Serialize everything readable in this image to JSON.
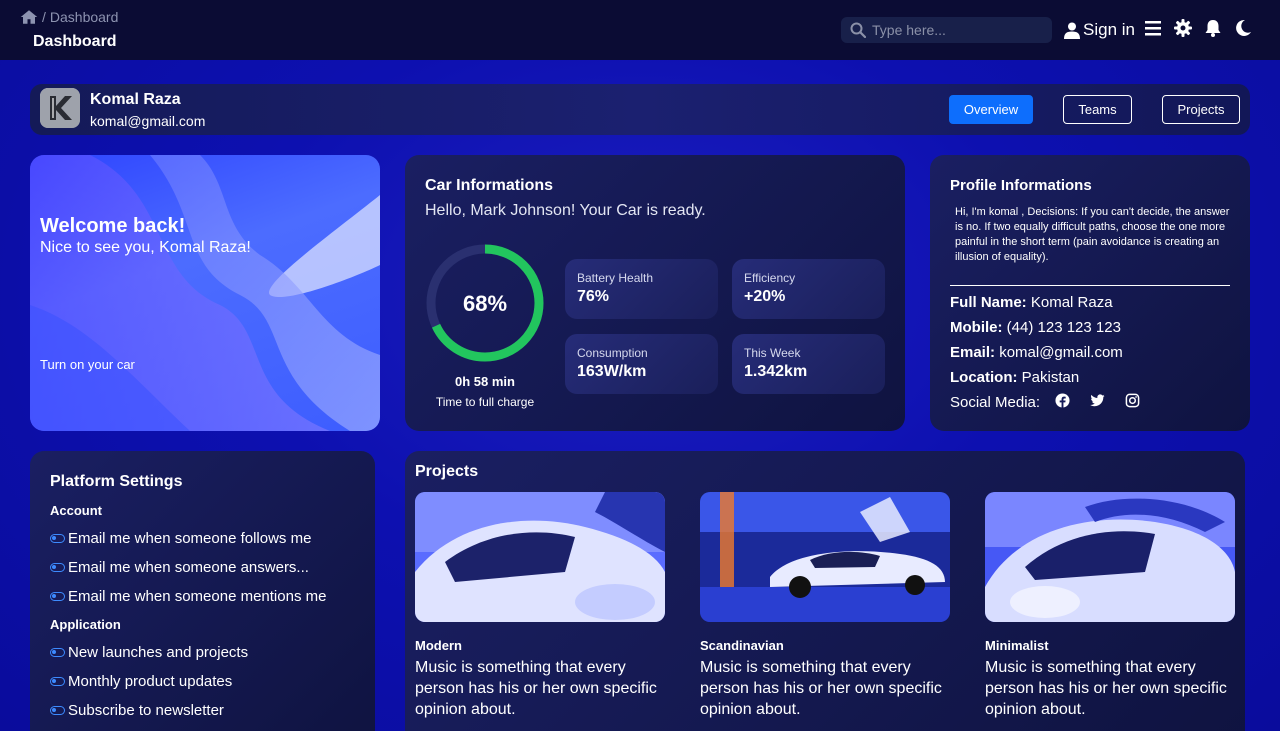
{
  "topbar": {
    "breadcrumb_sep": "/",
    "breadcrumb_current": "Dashboard",
    "page_title": "Dashboard",
    "search_placeholder": "Type here...",
    "signin_label": "Sign in",
    "icons": [
      "home-icon",
      "search-icon",
      "user-icon",
      "menu-icon",
      "gear-icon",
      "bell-icon",
      "moon-icon"
    ]
  },
  "profile_bar": {
    "name": "Komal Raza",
    "email": "komal@gmail.com",
    "tabs": [
      {
        "label": "Overview",
        "active": true
      },
      {
        "label": "Teams",
        "active": false
      },
      {
        "label": "Projects",
        "active": false
      }
    ]
  },
  "welcome": {
    "title": "Welcome back!",
    "subtitle": "Nice to see you, Komal Raza!",
    "cta": "Turn on your car"
  },
  "car": {
    "title": "Car Informations",
    "subtitle": "Hello, Mark Johnson! Your Car is ready.",
    "charge_percent": 68,
    "charge_label": "68%",
    "charge_time": "0h 58 min",
    "charge_time_label": "Time to full charge",
    "stats": [
      {
        "label": "Battery Health",
        "value": "76%"
      },
      {
        "label": "Efficiency",
        "value": "+20%"
      },
      {
        "label": "Consumption",
        "value": "163W/km"
      },
      {
        "label": "This Week",
        "value": "1.342km"
      }
    ],
    "accent": "#22c55e"
  },
  "profile_info": {
    "title": "Profile Informations",
    "bio": "Hi, I'm komal , Decisions: If you can't decide, the answer is no. If two equally difficult paths, choose the one more painful in the short term (pain avoidance is creating an illusion of equality).",
    "full_name_label": "Full Name:",
    "full_name": "Komal Raza",
    "mobile_label": "Mobile:",
    "mobile": "(44) 123 123 123",
    "email_label": "Email:",
    "email": "komal@gmail.com",
    "location_label": "Location:",
    "location": "Pakistan",
    "social_label": "Social Media:",
    "social_icons": [
      "facebook-icon",
      "twitter-icon",
      "instagram-icon"
    ]
  },
  "settings": {
    "title": "Platform Settings",
    "account_label": "Account",
    "account_items": [
      "Email me when someone follows me",
      "Email me when someone answers...",
      "Email me when someone mentions me"
    ],
    "application_label": "Application",
    "application_items": [
      "New launches and projects",
      "Monthly product updates",
      "Subscribe to newsletter"
    ]
  },
  "projects": {
    "title": "Projects",
    "items": [
      {
        "category": "Modern",
        "description": "Music is something that every person has his or her own specific opinion about."
      },
      {
        "category": "Scandinavian",
        "description": "Music is something that every person has his or her own specific opinion about."
      },
      {
        "category": "Minimalist",
        "description": "Music is something that every person has his or her own specific opinion about."
      }
    ]
  }
}
